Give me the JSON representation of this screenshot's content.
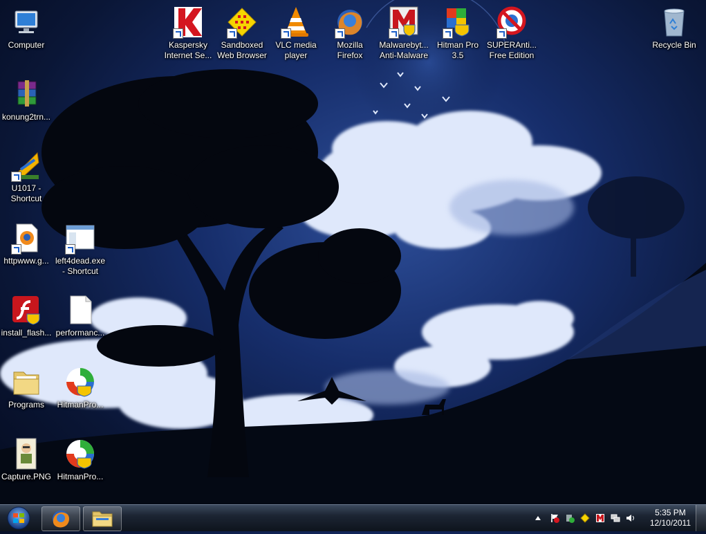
{
  "desktop": {
    "icons": [
      {
        "label": "Computer",
        "icon": "computer-icon"
      },
      {
        "label": "Kaspersky Internet Se...",
        "icon": "kaspersky-icon"
      },
      {
        "label": "Sandboxed Web Browser",
        "icon": "sandboxed-browser-icon"
      },
      {
        "label": "VLC media player",
        "icon": "vlc-icon"
      },
      {
        "label": "Mozilla Firefox",
        "icon": "firefox-icon"
      },
      {
        "label": "Malwarebyt... Anti-Malware",
        "icon": "malwarebytes-icon"
      },
      {
        "label": "Hitman Pro 3.5",
        "icon": "hitmanpro35-icon"
      },
      {
        "label": "SUPERAnti... Free Edition",
        "icon": "superantispyware-icon"
      },
      {
        "label": "Recycle Bin",
        "icon": "recycle-bin-icon"
      },
      {
        "label": "konung2trn...",
        "icon": "winrar-icon"
      },
      {
        "label": "U1017 - Shortcut",
        "icon": "game-shortcut-icon"
      },
      {
        "label": "httpwww.g...",
        "icon": "firefox-doc-icon"
      },
      {
        "label": "left4dead.exe - Shortcut",
        "icon": "exe-window-icon"
      },
      {
        "label": "install_flash...",
        "icon": "flash-installer-icon"
      },
      {
        "label": "performanc...",
        "icon": "blank-file-icon"
      },
      {
        "label": "Programs",
        "icon": "folder-icon"
      },
      {
        "label": "HitmanPro...",
        "icon": "hitmanpro-icon"
      },
      {
        "label": "Capture.PNG",
        "icon": "png-image-icon"
      },
      {
        "label": "HitmanPro...",
        "icon": "hitmanpro-icon"
      }
    ]
  },
  "taskbar": {
    "start_button": "start-orb-icon",
    "pinned": [
      {
        "name": "firefox-taskbar-button",
        "icon": "firefox-icon"
      },
      {
        "name": "explorer-taskbar-button",
        "icon": "folder-icon"
      }
    ],
    "tray": {
      "icons": [
        "show-hidden-icons",
        "action-center-icon",
        "security-shield-icon",
        "yellow-diamond-icon",
        "malwarebytes-tray-icon",
        "network-icon",
        "volume-icon"
      ],
      "time": "5:35 PM",
      "date": "12/10/2011"
    }
  }
}
